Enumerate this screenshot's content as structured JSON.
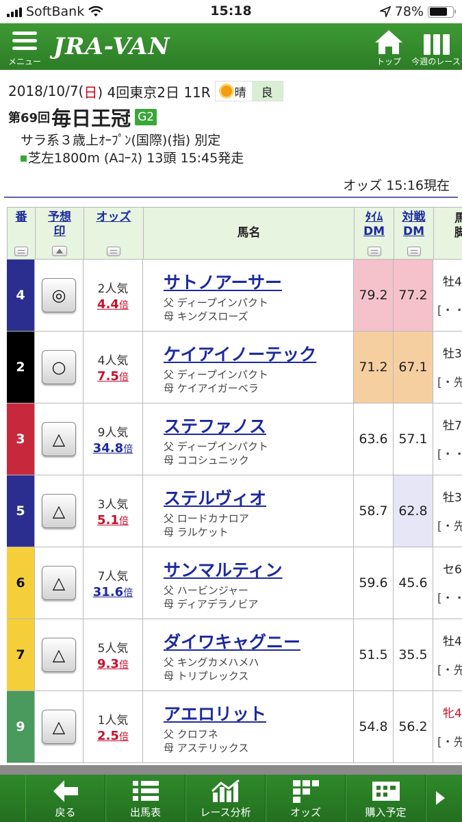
{
  "status": {
    "carrier": "SoftBank",
    "time": "15:18",
    "battery": "78%",
    "battery_level": 0.78
  },
  "header": {
    "menu_label": "メニュー",
    "logo": "JRA-VAN",
    "top_label": "トップ",
    "week_label": "今週のレース"
  },
  "race": {
    "date_prefix": "2018/10/7(",
    "weekday": "日",
    "date_suffix": ") 4回東京2日 11R",
    "weather": "晴",
    "track": "良",
    "number": "第69回",
    "name": "毎日王冠",
    "grade": "G2",
    "conditions": "サラ系３歳上ｵｰﾌﾟﾝ(国際)(指) 別定",
    "course": "芝左1800m (Aｺｰｽ) 13頭 15:45発走",
    "odds_time": "オッズ 15:16現在"
  },
  "table": {
    "headers": {
      "num": "番",
      "mark_1": "予想",
      "mark_2": "印",
      "odds": "オッズ",
      "name": "馬名",
      "time_dm_1": "ﾀｲﾑ",
      "time_dm_2": "DM",
      "match_dm_1": "対戦",
      "match_dm_2": "DM",
      "extra_1": "馬",
      "extra_2": "脚"
    },
    "odds_unit": "倍",
    "rows": [
      {
        "num": "4",
        "num_bg": "#2b2e8f",
        "mark": "◎",
        "popularity": "2人気",
        "odds": "4.4",
        "odds_color": "#c8102e",
        "horse": "サトノアーサー",
        "sire": "父 ディープインパクト",
        "dam": "母 キングスローズ",
        "time_dm": "79.2",
        "time_bg": "#f5c2cc",
        "match_dm": "77.2",
        "match_bg": "#f5c2cc",
        "sex": "牡4",
        "sex_color": "#222",
        "note": "[・・"
      },
      {
        "num": "2",
        "num_bg": "#000000",
        "mark": "○",
        "popularity": "4人気",
        "odds": "7.5",
        "odds_color": "#c8102e",
        "horse": "ケイアイノーテック",
        "sire": "父 ディープインパクト",
        "dam": "母 ケイアイガーベラ",
        "time_dm": "71.2",
        "time_bg": "#f6cfa1",
        "match_dm": "67.1",
        "match_bg": "#f6cfa1",
        "sex": "牡3",
        "sex_color": "#222",
        "note": "[・先"
      },
      {
        "num": "3",
        "num_bg": "#c8283c",
        "mark": "△",
        "popularity": "9人気",
        "odds": "34.8",
        "odds_color": "#1d2a9c",
        "horse": "ステファノス",
        "sire": "父 ディープインパクト",
        "dam": "母 ココシュニック",
        "time_dm": "63.6",
        "time_bg": "#ffffff",
        "match_dm": "57.1",
        "match_bg": "#ffffff",
        "sex": "牡7",
        "sex_color": "#222",
        "note": "[・・"
      },
      {
        "num": "5",
        "num_bg": "#2b2e8f",
        "mark": "△",
        "popularity": "3人気",
        "odds": "5.1",
        "odds_color": "#c8102e",
        "horse": "ステルヴィオ",
        "sire": "父 ロードカナロア",
        "dam": "母 ラルケット",
        "time_dm": "58.7",
        "time_bg": "#ffffff",
        "match_dm": "62.8",
        "match_bg": "#e6e6f7",
        "sex": "牡3",
        "sex_color": "#222",
        "note": "[・先"
      },
      {
        "num": "6",
        "num_bg": "#f5cf3a",
        "mark": "△",
        "popularity": "7人気",
        "odds": "31.6",
        "odds_color": "#1d2a9c",
        "horse": "サンマルティン",
        "sire": "父 ハービンジャー",
        "dam": "母 ディアデラノビア",
        "time_dm": "59.6",
        "time_bg": "#ffffff",
        "match_dm": "45.6",
        "match_bg": "#ffffff",
        "sex": "セ6",
        "sex_color": "#222",
        "note": "[・・"
      },
      {
        "num": "7",
        "num_bg": "#f5cf3a",
        "mark": "△",
        "popularity": "5人気",
        "odds": "9.3",
        "odds_color": "#c8102e",
        "horse": "ダイワキャグニー",
        "sire": "父 キングカメハメハ",
        "dam": "母 トリプレックス",
        "time_dm": "51.5",
        "time_bg": "#ffffff",
        "match_dm": "35.5",
        "match_bg": "#ffffff",
        "sex": "牡4",
        "sex_color": "#222",
        "note": "[・先"
      },
      {
        "num": "9",
        "num_bg": "#4a9a5e",
        "mark": "△",
        "popularity": "1人気",
        "odds": "2.5",
        "odds_color": "#c8102e",
        "horse": "アエロリット",
        "sire": "父 クロフネ",
        "dam": "母 アステリックス",
        "time_dm": "54.8",
        "time_bg": "#ffffff",
        "match_dm": "56.2",
        "match_bg": "#ffffff",
        "sex": "牝4",
        "sex_color": "#c8102e",
        "note": "[・先"
      }
    ]
  },
  "toolbar": {
    "back": "戻る",
    "entries": "出馬表",
    "analysis": "レース分析",
    "odds": "オッズ",
    "purchase": "購入予定"
  }
}
